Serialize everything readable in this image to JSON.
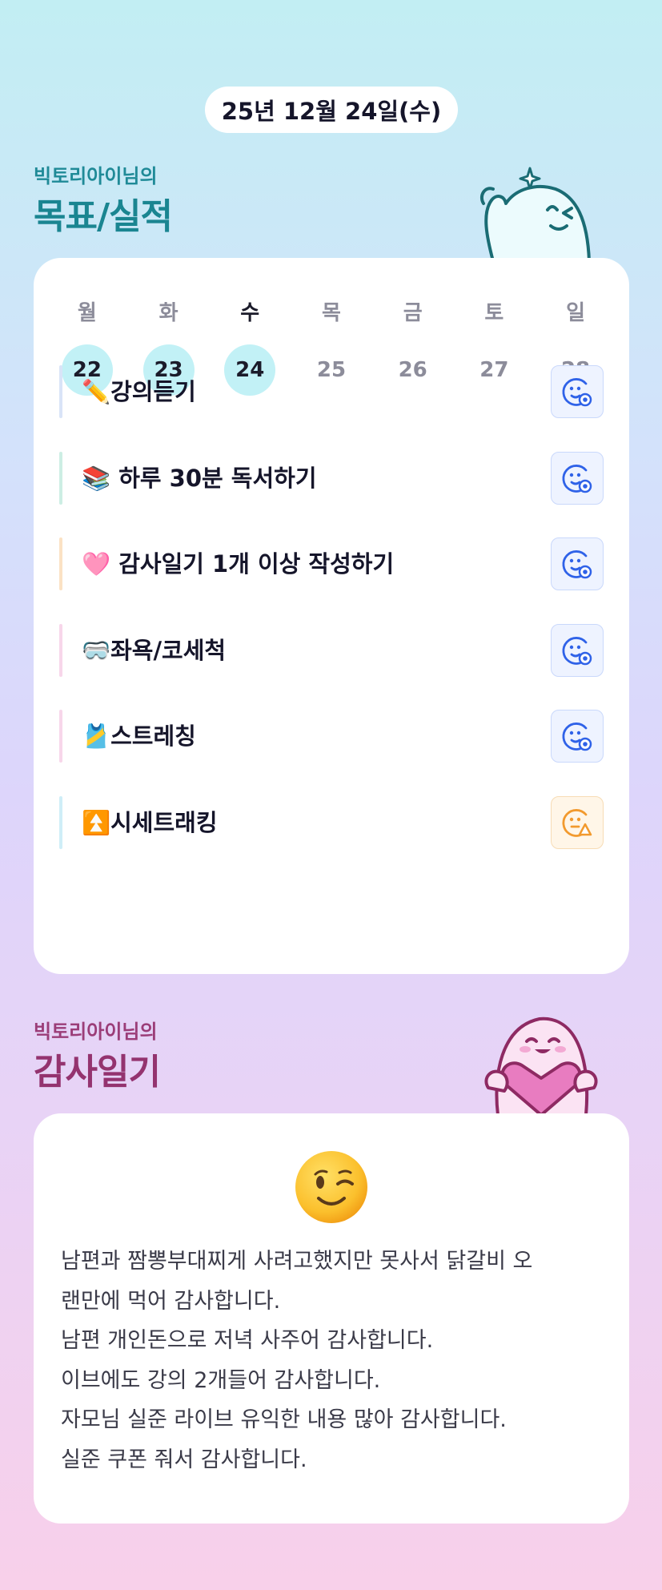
{
  "date": "25년 12월 24일(수)",
  "goals_section": {
    "subtitle": "빅토리아이님의",
    "title": "목표/실적"
  },
  "week": {
    "days_of_week": [
      "월",
      "화",
      "수",
      "목",
      "금",
      "토",
      "일"
    ],
    "dates": [
      "22",
      "23",
      "24",
      "25",
      "26",
      "27",
      "28"
    ],
    "completed_dates": [
      "22",
      "23",
      "24"
    ],
    "today": "24"
  },
  "goals": [
    {
      "label": "✏️강의듣기",
      "bar_color": "#d9e4f7",
      "status": "done",
      "status_icon": "smile-check-icon"
    },
    {
      "label": "📚 하루 30분 독서하기",
      "bar_color": "#cdeee4",
      "status": "done",
      "status_icon": "smile-check-icon"
    },
    {
      "label": "🩷 감사일기 1개 이상 작성하기",
      "bar_color": "#fbe2c4",
      "status": "done",
      "status_icon": "smile-check-icon"
    },
    {
      "label": "🥽좌욕/코세척",
      "bar_color": "#f7d6ea",
      "status": "done",
      "status_icon": "smile-check-icon"
    },
    {
      "label": "🎽스트레칭",
      "bar_color": "#f7d6ea",
      "status": "done",
      "status_icon": "smile-check-icon"
    },
    {
      "label": "⏫시세트래킹",
      "bar_color": "#cfeef7",
      "status": "warning",
      "status_icon": "neutral-warning-icon"
    }
  ],
  "colors": {
    "done_icon": "#2f62e8",
    "warn_icon": "#f29a2e"
  },
  "diary_section": {
    "subtitle": "빅토리아이님의",
    "title": "감사일기"
  },
  "diary": {
    "mood_icon": "winking-face-icon",
    "text": "남편과 짬뽕부대찌게 사려고했지만 못사서 닭갈비 오\n랜만에 먹어 감사합니다.\n남편 개인돈으로 저녁 사주어 감사합니다.\n이브에도 강의 2개들어 감사합니다.\n자모님 실준 라이브 유익한 내용 많아 감사합니다.\n실준 쿠폰 줘서 감사합니다."
  }
}
